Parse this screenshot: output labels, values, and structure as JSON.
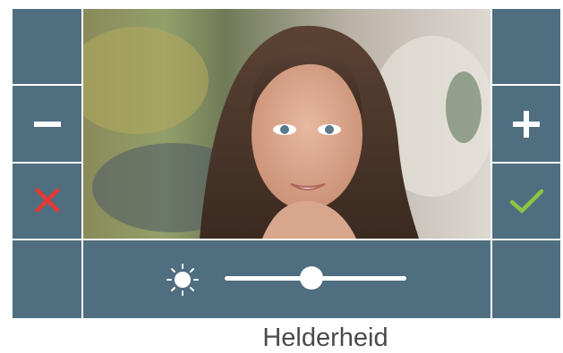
{
  "screen": {
    "caption": "Helderheid",
    "brightness_level_percent": 48,
    "icons": {
      "minus": "minus-icon",
      "plus": "plus-icon",
      "cancel": "close-icon",
      "confirm": "checkmark-icon",
      "brightness": "sun-icon"
    },
    "colors": {
      "panel": "#4f6e80",
      "cancel": "#e53935",
      "confirm": "#8cc63f"
    }
  }
}
